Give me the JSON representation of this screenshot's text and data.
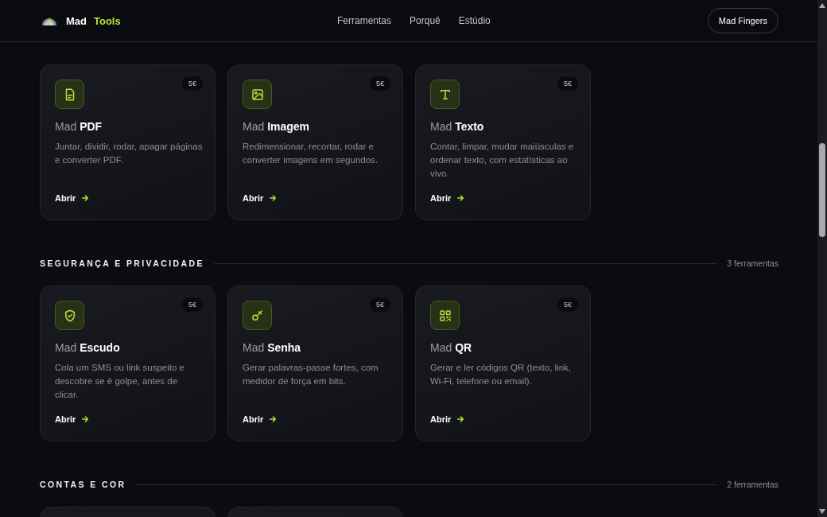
{
  "header": {
    "logo": {
      "word": "Mad",
      "accent": "Tools"
    },
    "nav": [
      "Ferramentas",
      "Porquê",
      "Estúdio"
    ],
    "button": "Mad Fingers"
  },
  "sections": [
    {
      "tools": [
        {
          "kind": "card",
          "prefix": "Mad",
          "name": "PDF",
          "price": "5€",
          "description": "Juntar, dividir, rodar, apagar páginas e converter PDF.",
          "link": "Abrir"
        },
        {
          "kind": "card",
          "prefix": "Mad",
          "name": "Imagem",
          "price": "5€",
          "description": "Redimensionar, recortar, rodar e converter imagens em segundos.",
          "link": "Abrir"
        },
        {
          "kind": "card",
          "prefix": "Mad",
          "name": "Texto",
          "price": "5€",
          "description": "Contar, limpar, mudar maiúsculas e ordenar texto, com estatísticas ao vivo.",
          "link": "Abrir"
        }
      ]
    },
    {
      "title": "SEGURANÇA E PRIVACIDADE",
      "count": "3 ferramentas",
      "tools": [
        {
          "kind": "card",
          "prefix": "Mad",
          "name": "Escudo",
          "price": "5€",
          "description": "Cola um SMS ou link suspeito e descobre se é golpe, antes de clicar.",
          "link": "Abrir"
        },
        {
          "kind": "card",
          "prefix": "Mad",
          "name": "Senha",
          "price": "5€",
          "description": "Gerar palavras-passe fortes, com medidor de força em bits.",
          "link": "Abrir"
        },
        {
          "kind": "card",
          "prefix": "Mad",
          "name": "QR",
          "price": "5€",
          "description": "Gerar e ler códigos QR (texto, link, Wi-Fi, telefone ou email).",
          "link": "Abrir"
        }
      ]
    },
    {
      "title": "CONTAS E COR",
      "count": "2 ferramentas",
      "tools": [
        {
          "kind": "cut"
        },
        {
          "kind": "cut"
        }
      ]
    }
  ]
}
